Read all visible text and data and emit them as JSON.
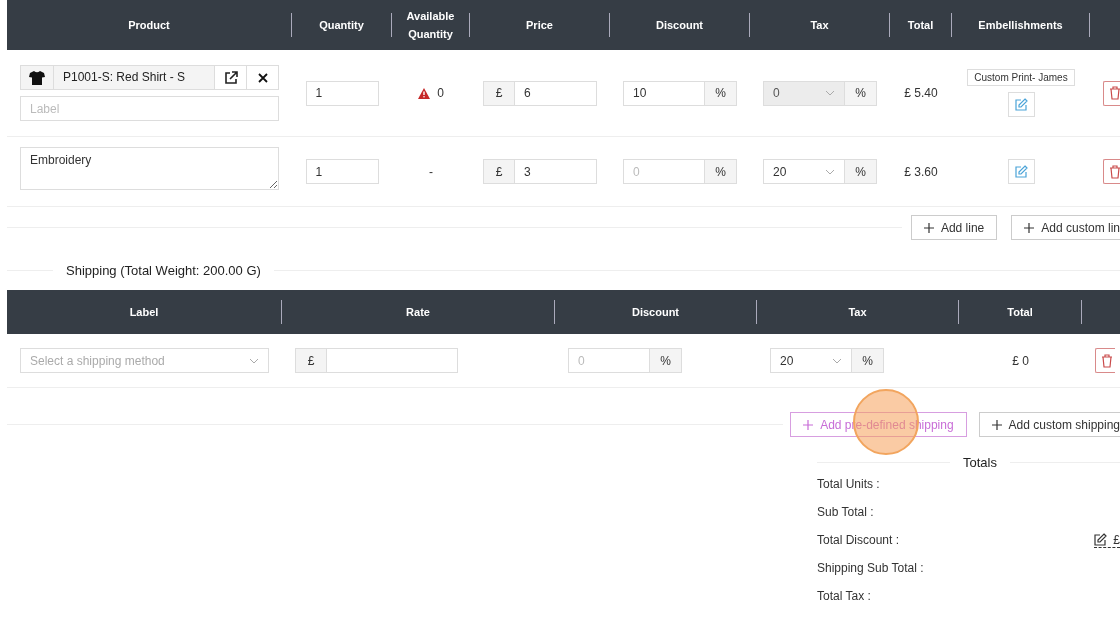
{
  "products_table": {
    "columns": [
      "Product",
      "Quantity",
      "Available Quantity",
      "Price",
      "Discount",
      "Tax",
      "Total",
      "Embellishments"
    ],
    "rows": [
      {
        "kind": "product",
        "product": "P1001-S: Red Shirt - S",
        "label_placeholder": "Label",
        "quantity": "1",
        "available": "0",
        "stock_warning": true,
        "currency": "£",
        "price": "6",
        "discount": "10",
        "discount_unit": "%",
        "tax": "0",
        "tax_disabled": true,
        "tax_unit": "%",
        "total": "£ 5.40",
        "embellishments": [
          "Custom Print- James"
        ]
      },
      {
        "kind": "custom",
        "label": "Embroidery",
        "quantity": "1",
        "available": "-",
        "stock_warning": false,
        "currency": "£",
        "price": "3",
        "discount_placeholder": "0",
        "discount_unit": "%",
        "tax": "20",
        "tax_disabled": false,
        "tax_unit": "%",
        "total": "£ 3.60",
        "embellishments": []
      }
    ],
    "buttons": [
      {
        "label": "Add line",
        "highlighted": false
      },
      {
        "label": "Add custom lin",
        "highlighted": false
      }
    ]
  },
  "shipping": {
    "title": "Shipping (Total Weight: 200.00 G)",
    "columns": [
      "Label",
      "Rate",
      "Discount",
      "Tax",
      "Total"
    ],
    "rows": [
      {
        "method_placeholder": "Select a shipping method",
        "currency": "£",
        "discount_placeholder": "0",
        "discount_unit": "%",
        "tax": "20",
        "tax_unit": "%",
        "total": "£ 0"
      }
    ],
    "buttons": [
      {
        "label": "Add pre-defined shipping",
        "highlighted": true
      },
      {
        "label": "Add custom shipping",
        "highlighted": false
      }
    ]
  },
  "totals": {
    "title": "Totals",
    "rows": [
      {
        "label": "Total Units :",
        "editable": false
      },
      {
        "label": "Sub Total :",
        "editable": false
      },
      {
        "label": "Total Discount :",
        "editable": true,
        "value": "£"
      },
      {
        "label": "Shipping Sub Total :",
        "editable": false
      },
      {
        "label": "Total Tax :",
        "editable": false
      }
    ]
  },
  "click_highlight": true
}
